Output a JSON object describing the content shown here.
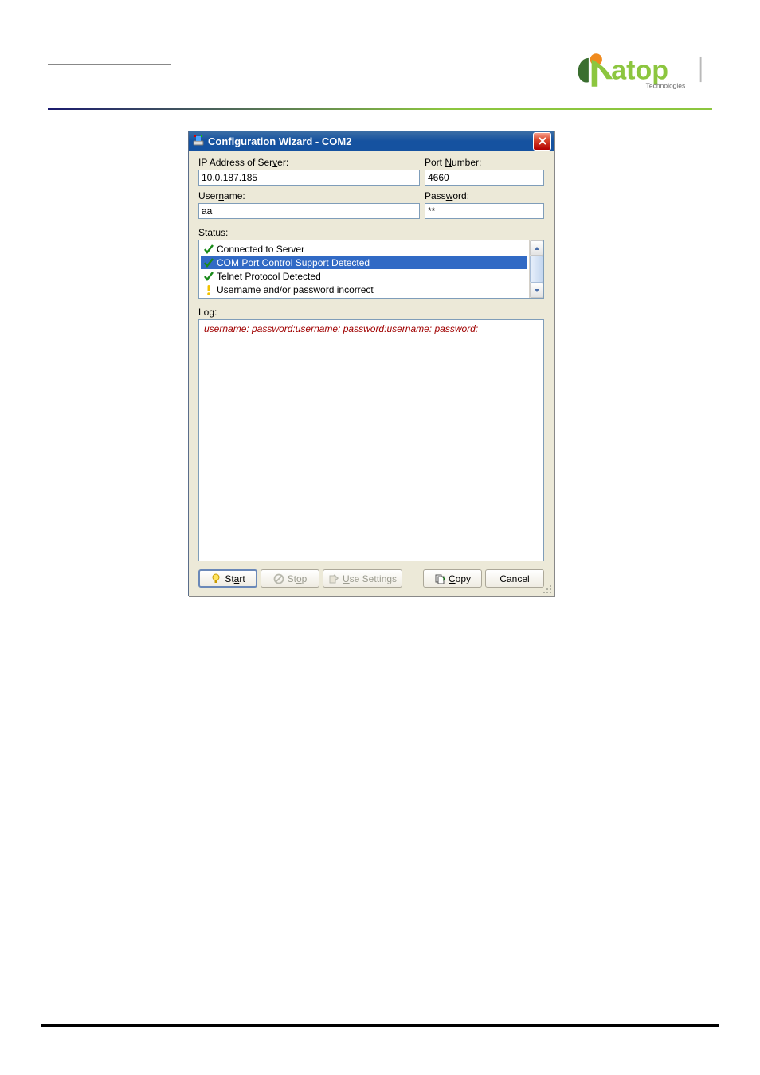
{
  "brand": {
    "name": "atop",
    "tagline": "Technologies"
  },
  "dialog": {
    "title": "Configuration Wizard - COM2",
    "fields": {
      "ip_label_pre": "IP Address of Ser",
      "ip_label_u": "v",
      "ip_label_post": "er:",
      "ip_value": "10.0.187.185",
      "port_label_pre": "Port ",
      "port_label_u": "N",
      "port_label_post": "umber:",
      "port_value": "4660",
      "user_label_pre": "User",
      "user_label_u": "n",
      "user_label_post": "ame:",
      "user_value": "aa",
      "pass_label_pre": "Pass",
      "pass_label_u": "w",
      "pass_label_post": "ord:",
      "pass_value": "**"
    },
    "status_label": "Status:",
    "status_items": [
      {
        "text": "Connected to Server",
        "icon": "check",
        "selected": false
      },
      {
        "text": "COM Port Control Support Detected",
        "icon": "check",
        "selected": true
      },
      {
        "text": "Telnet Protocol Detected",
        "icon": "check",
        "selected": false
      },
      {
        "text": "Username and/or password incorrect",
        "icon": "warn",
        "selected": false
      }
    ],
    "log_label": "Log:",
    "log_text": "username: password:username: password:username: password:",
    "buttons": {
      "start_pre": "St",
      "start_u": "a",
      "start_post": "rt",
      "stop_pre": "St",
      "stop_u": "o",
      "stop_post": "p",
      "use_pre": "",
      "use_u": "U",
      "use_post": "se Settings",
      "copy_pre": "",
      "copy_u": "C",
      "copy_post": "opy",
      "cancel": "Cancel"
    }
  }
}
